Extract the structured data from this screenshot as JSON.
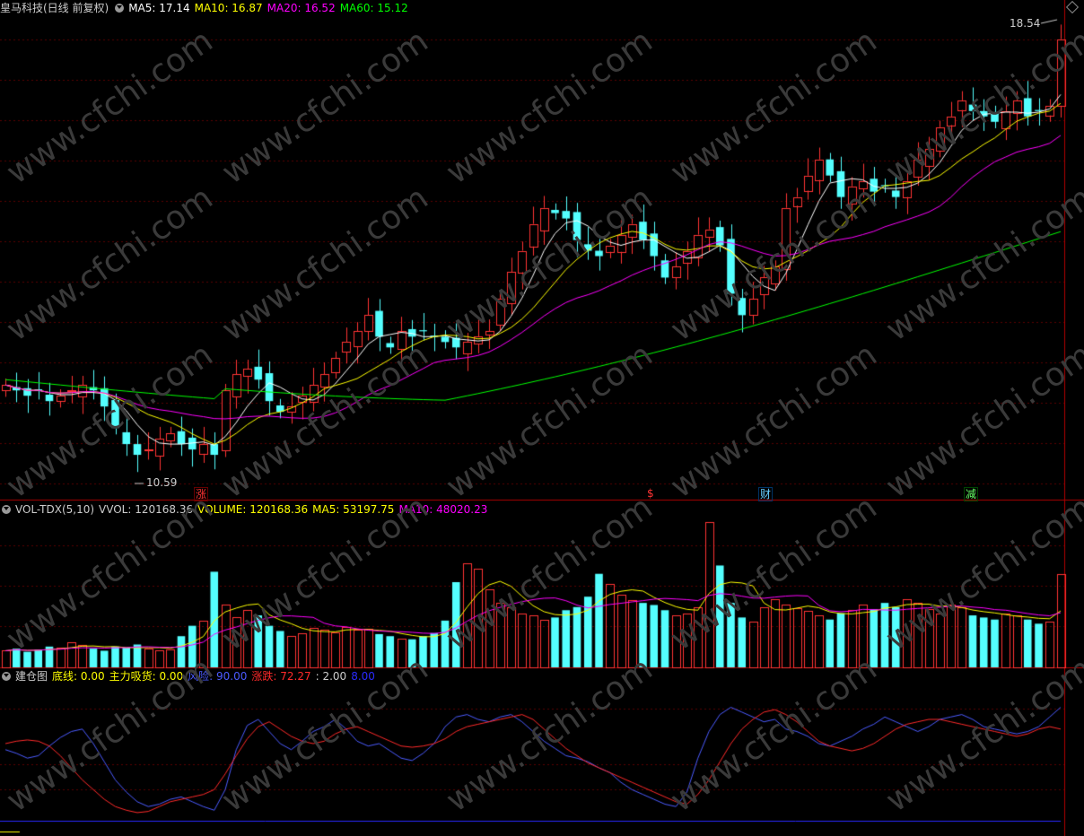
{
  "window": {
    "panel_main": {
      "title": "皇马科技(日线 前复权)",
      "indicators": [
        {
          "label": "MA5: 17.14",
          "color": "#ffffff"
        },
        {
          "label": "MA10: 16.87",
          "color": "#ffff00"
        },
        {
          "label": "MA20: 16.52",
          "color": "#ff00ff"
        },
        {
          "label": "MA60: 15.12",
          "color": "#00ff00"
        }
      ],
      "high_marker": "18.54",
      "low_marker": "10.59",
      "events": [
        {
          "label": "涨",
          "color": "#ff3333"
        },
        {
          "label": "$",
          "color": "#ff3333"
        },
        {
          "label": "财",
          "color": "#66ccff"
        },
        {
          "label": "减",
          "color": "#66ff66"
        }
      ]
    },
    "panel_vol": {
      "title": "VOL-TDX(5,10)",
      "indicators": [
        {
          "label": "VVOL: 120168.36",
          "color": "#cccccc"
        },
        {
          "label": "VOLUME: 120168.36",
          "color": "#ffff00"
        },
        {
          "label": "MA5: 53197.75",
          "color": "#ffff00"
        },
        {
          "label": "MA10: 48020.23",
          "color": "#ff00ff"
        }
      ]
    },
    "panel_ind": {
      "title": "建仓图",
      "indicators": [
        {
          "label": "底线: 0.00",
          "color": "#ffff00"
        },
        {
          "label": "主力吸货: 0.00",
          "color": "#ffff00"
        },
        {
          "label": "风险: 90.00",
          "color": "#4b5bff"
        },
        {
          "label": "涨跌: 72.27",
          "color": "#ff2a2a"
        },
        {
          "label": ": 2.00",
          "color": "#cccccc"
        },
        {
          "label": "8.00",
          "color": "#2a2aff"
        }
      ]
    },
    "watermark": "www.cfchi.com",
    "colors": {
      "up": "#ff3333",
      "down": "#54ffff",
      "grid": "#5a0000",
      "ma5": "#ffffff",
      "ma10": "#ffff00",
      "ma20": "#ff00ff",
      "ma60": "#00ff00",
      "risk": "#4b5bff",
      "trend": "#ff2a2a"
    }
  },
  "chart_data": {
    "type": "candlestick",
    "price_ticks_shown": {
      "high": 18.54,
      "low": 10.59
    },
    "close_path": [
      12.1,
      12.0,
      11.9,
      12.0,
      11.8,
      11.9,
      12.0,
      12.1,
      12.0,
      11.7,
      11.3,
      11.0,
      10.8,
      10.9,
      11.1,
      11.2,
      11.0,
      10.9,
      11.0,
      10.8,
      12.0,
      12.3,
      12.4,
      12.2,
      11.8,
      11.6,
      11.7,
      11.9,
      12.1,
      12.3,
      12.6,
      12.9,
      13.1,
      13.4,
      13.0,
      12.8,
      13.1,
      13.0,
      13.1,
      13.0,
      12.9,
      12.8,
      12.9,
      13.0,
      13.1,
      13.7,
      14.2,
      14.6,
      15.1,
      15.4,
      15.3,
      15.2,
      14.8,
      14.6,
      14.5,
      14.7,
      14.9,
      15.1,
      14.8,
      14.5,
      14.1,
      14.3,
      14.6,
      14.9,
      15.0,
      14.7,
      13.8,
      13.4,
      13.7,
      14.1,
      14.3,
      15.4,
      15.6,
      16.0,
      16.3,
      16.0,
      15.6,
      15.8,
      15.9,
      15.7,
      15.8,
      15.6,
      15.9,
      16.3,
      16.5,
      16.9,
      17.1,
      17.4,
      17.2,
      17.1,
      17.0,
      17.2,
      17.4,
      17.1,
      17.2,
      17.3,
      18.54
    ],
    "volume_path": [
      0.16,
      0.18,
      0.15,
      0.17,
      0.2,
      0.19,
      0.24,
      0.22,
      0.18,
      0.16,
      0.2,
      0.19,
      0.22,
      0.18,
      0.16,
      0.17,
      0.3,
      0.4,
      0.45,
      0.92,
      0.6,
      0.48,
      0.55,
      0.5,
      0.4,
      0.35,
      0.3,
      0.33,
      0.38,
      0.36,
      0.34,
      0.39,
      0.36,
      0.37,
      0.32,
      0.3,
      0.28,
      0.27,
      0.3,
      0.33,
      0.45,
      0.82,
      1.0,
      0.95,
      0.75,
      0.62,
      0.58,
      0.52,
      0.5,
      0.46,
      0.48,
      0.55,
      0.58,
      0.68,
      0.9,
      0.8,
      0.7,
      0.65,
      0.62,
      0.6,
      0.55,
      0.5,
      0.52,
      0.58,
      1.4,
      0.98,
      0.62,
      0.48,
      0.44,
      0.58,
      0.66,
      0.6,
      0.57,
      0.54,
      0.5,
      0.46,
      0.52,
      0.55,
      0.6,
      0.56,
      0.62,
      0.58,
      0.66,
      0.62,
      0.56,
      0.52,
      0.6,
      0.58,
      0.5,
      0.48,
      0.46,
      0.52,
      0.5,
      0.46,
      0.42,
      0.44,
      0.9
    ],
    "risk_path": [
      55,
      52,
      48,
      50,
      58,
      65,
      70,
      72,
      60,
      45,
      30,
      20,
      12,
      8,
      10,
      14,
      16,
      12,
      8,
      5,
      22,
      55,
      75,
      80,
      70,
      60,
      55,
      62,
      70,
      74,
      80,
      72,
      62,
      58,
      60,
      54,
      48,
      46,
      52,
      60,
      74,
      82,
      84,
      80,
      78,
      82,
      84,
      78,
      70,
      62,
      56,
      50,
      48,
      45,
      40,
      36,
      28,
      22,
      18,
      14,
      10,
      8,
      20,
      48,
      70,
      84,
      90,
      86,
      82,
      78,
      80,
      72,
      70,
      66,
      60,
      58,
      62,
      66,
      72,
      76,
      82,
      78,
      74,
      70,
      74,
      80,
      82,
      84,
      80,
      74,
      72,
      70,
      68,
      70,
      74,
      82,
      90
    ],
    "trend_path": [
      60,
      62,
      63,
      62,
      58,
      50,
      40,
      30,
      22,
      14,
      8,
      5,
      3,
      4,
      8,
      12,
      14,
      16,
      18,
      22,
      35,
      50,
      64,
      74,
      78,
      72,
      66,
      62,
      60,
      62,
      68,
      72,
      74,
      70,
      66,
      62,
      58,
      57,
      58,
      60,
      64,
      70,
      74,
      76,
      78,
      80,
      82,
      84,
      80,
      72,
      64,
      56,
      50,
      44,
      40,
      36,
      32,
      28,
      24,
      20,
      16,
      12,
      10,
      18,
      30,
      45,
      60,
      72,
      80,
      86,
      88,
      84,
      78,
      70,
      62,
      58,
      56,
      54,
      56,
      60,
      66,
      72,
      76,
      78,
      80,
      80,
      78,
      76,
      74,
      72,
      70,
      68,
      66,
      68,
      72,
      74,
      72
    ]
  }
}
